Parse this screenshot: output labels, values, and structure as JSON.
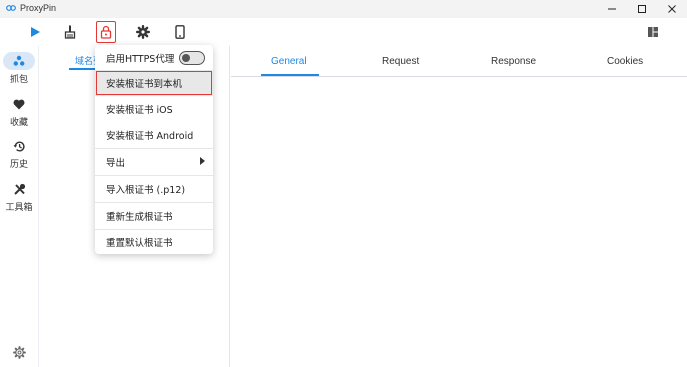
{
  "window": {
    "title": "ProxyPin"
  },
  "toolbar": {
    "buttons": [
      {
        "icon": "play-icon"
      },
      {
        "icon": "broom-icon"
      },
      {
        "icon": "lock-icon"
      },
      {
        "icon": "gear-icon"
      },
      {
        "icon": "phone-icon"
      }
    ],
    "layout_icon": "layout-icon"
  },
  "nav": {
    "items": [
      {
        "label": "抓包",
        "icon": "capture-icon"
      },
      {
        "label": "收藏",
        "icon": "heart-icon"
      },
      {
        "label": "历史",
        "icon": "history-icon"
      },
      {
        "label": "工具箱",
        "icon": "tools-icon"
      }
    ],
    "settings_icon": "settings-icon"
  },
  "left_panel": {
    "tab_label": "域名列"
  },
  "detail_tabs": [
    "General",
    "Request",
    "Response",
    "Cookies"
  ],
  "menu": {
    "items": [
      {
        "label": "启用HTTPS代理",
        "has_toggle": true,
        "toggle_on": false
      },
      {
        "label": "安装根证书到本机",
        "highlighted": true
      },
      {
        "label": "安装根证书 iOS"
      },
      {
        "label": "安装根证书 Android"
      },
      {
        "label": "导出",
        "has_submenu": true
      },
      {
        "label": "导入根证书 (.p12)"
      },
      {
        "label": "重新生成根证书"
      },
      {
        "label": "重置默认根证书"
      }
    ]
  },
  "colors": {
    "accent": "#1e88e5",
    "highlight_box": "#e53935",
    "nav_selected_bg": "#d9e7f7"
  }
}
